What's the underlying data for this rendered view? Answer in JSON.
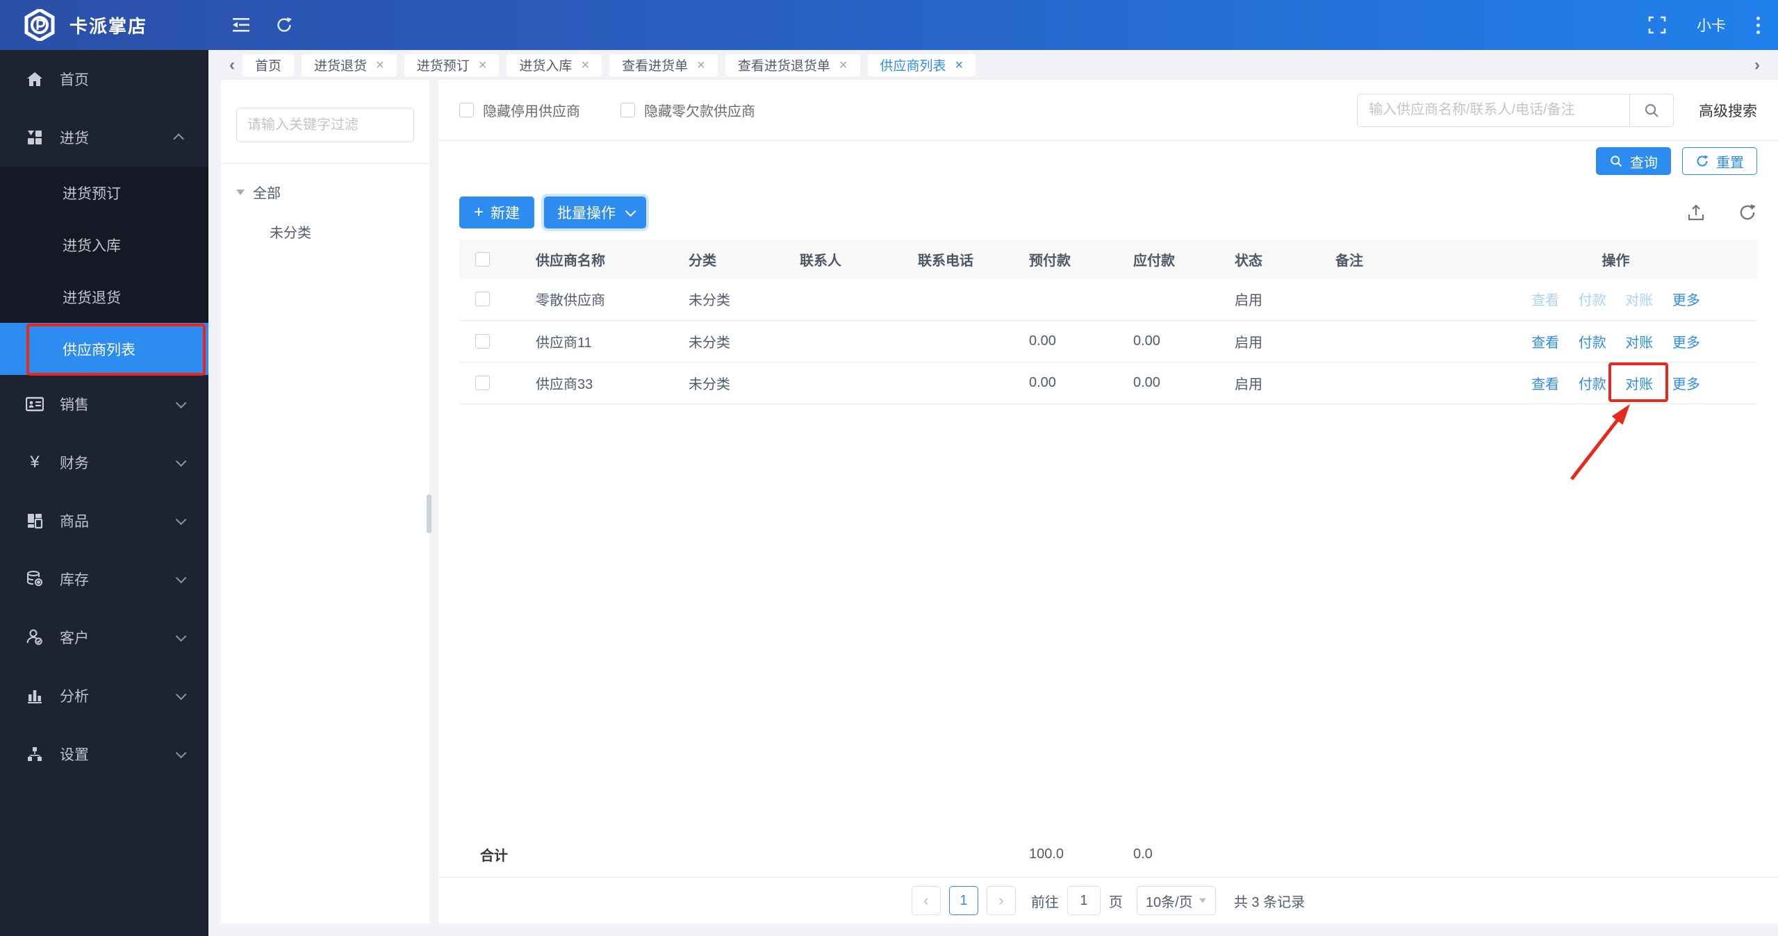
{
  "topbar": {
    "app_name": "卡派掌店",
    "username": "小卡",
    "icons": [
      "menu-fold",
      "refresh",
      "fullscreen",
      "kebab-menu"
    ]
  },
  "sidebar": {
    "items": [
      {
        "label": "首页",
        "icon": "home-icon"
      },
      {
        "label": "进货",
        "icon": "purchase-icon",
        "expanded": true,
        "children": [
          {
            "label": "进货预订"
          },
          {
            "label": "进货入库"
          },
          {
            "label": "进货退货"
          },
          {
            "label": "供应商列表",
            "active": true
          }
        ]
      },
      {
        "label": "销售",
        "icon": "sales-icon"
      },
      {
        "label": "财务",
        "icon": "finance-icon"
      },
      {
        "label": "商品",
        "icon": "goods-icon"
      },
      {
        "label": "库存",
        "icon": "inventory-icon"
      },
      {
        "label": "客户",
        "icon": "customers-icon"
      },
      {
        "label": "分析",
        "icon": "analysis-icon"
      },
      {
        "label": "设置",
        "icon": "settings-icon"
      }
    ]
  },
  "tabs": [
    {
      "label": "首页",
      "closable": false
    },
    {
      "label": "进货退货",
      "closable": true
    },
    {
      "label": "进货预订",
      "closable": true
    },
    {
      "label": "进货入库",
      "closable": true
    },
    {
      "label": "查看进货单",
      "closable": true
    },
    {
      "label": "查看进货退货单",
      "closable": true
    },
    {
      "label": "供应商列表",
      "closable": true,
      "active": true
    }
  ],
  "filter_panel": {
    "search_placeholder": "请输入关键字过滤",
    "tree_root": "全部",
    "tree_child": "未分类"
  },
  "filters": {
    "hide_disabled_label": "隐藏停用供应商",
    "hide_zero_label": "隐藏零欠款供应商",
    "search_placeholder": "输入供应商名称/联系人/电话/备注",
    "advanced_label": "高级搜索",
    "query_label": "查询",
    "reset_label": "重置"
  },
  "toolbar": {
    "new_label": "新建",
    "batch_label": "批量操作"
  },
  "table": {
    "columns": [
      "供应商名称",
      "分类",
      "联系人",
      "联系电话",
      "预付款",
      "应付款",
      "状态",
      "备注",
      "操作"
    ],
    "action_labels": [
      "查看",
      "付款",
      "对账",
      "更多"
    ],
    "rows": [
      {
        "name": "零散供应商",
        "category": "未分类",
        "contact": "",
        "phone": "",
        "prepay": "",
        "payable": "",
        "status": "启用",
        "remark": "",
        "disabled_actions": [
          "查看",
          "付款",
          "对账"
        ]
      },
      {
        "name": "供应商11",
        "category": "未分类",
        "contact": "",
        "phone": "",
        "prepay": "0.00",
        "payable": "0.00",
        "status": "启用",
        "remark": ""
      },
      {
        "name": "供应商33",
        "category": "未分类",
        "contact": "",
        "phone": "",
        "prepay": "0.00",
        "payable": "0.00",
        "status": "启用",
        "remark": "",
        "annotated_action": "对账"
      }
    ],
    "summary": {
      "label": "合计",
      "prepay": "100.0",
      "payable": "0.0"
    }
  },
  "pagination": {
    "current_page": "1",
    "goto_label": "前往",
    "goto_value": "1",
    "unit_label": "页",
    "page_size": "10条/页",
    "total_label": "共 3 条记录"
  },
  "colors": {
    "accent": "#2d8cf0",
    "topbar_left": "#2a4fa8",
    "topbar_right": "#2080eb",
    "sidebar_bg": "#1d2330",
    "submenu_bg": "#141925",
    "annotation_red": "#e8281c"
  },
  "annotations": {
    "highlighted_sidebar_item": "供应商列表",
    "highlighted_table_action": "对账"
  }
}
